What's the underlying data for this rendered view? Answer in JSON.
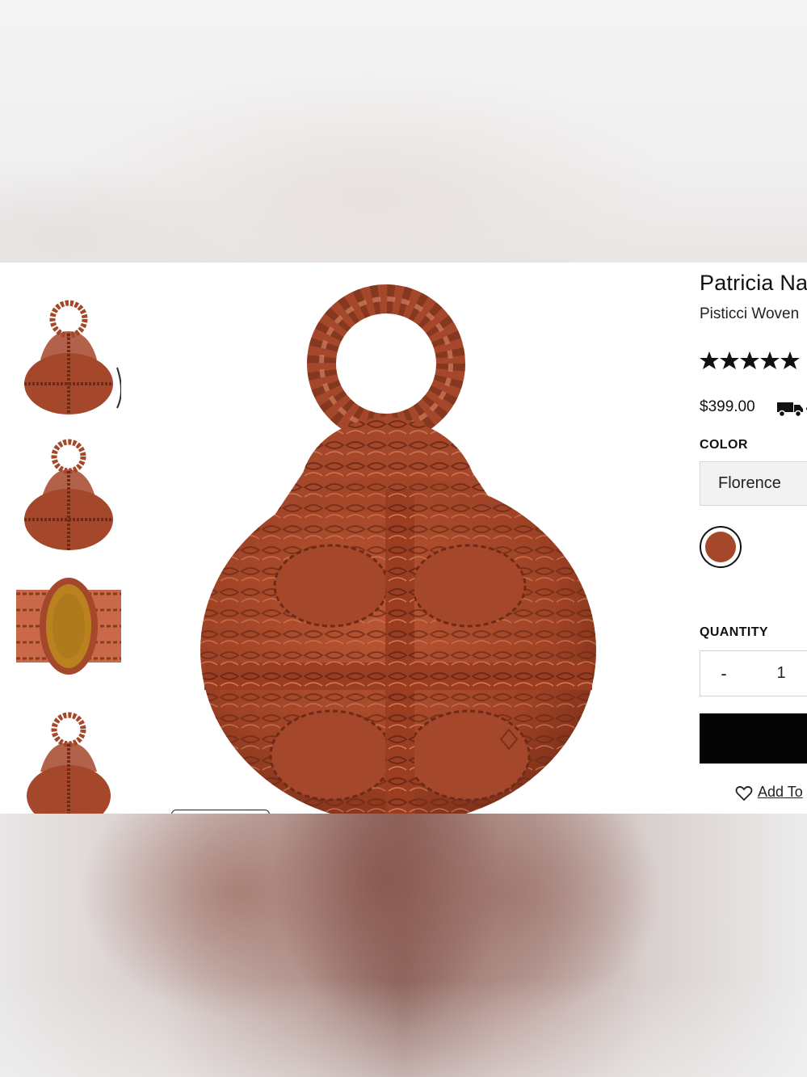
{
  "product": {
    "brand": "Patricia Na",
    "subtitle": "Pisticci Woven",
    "rating_stars": 5,
    "price": "$399.00"
  },
  "color": {
    "label": "COLOR",
    "selected": "Florence",
    "swatches": [
      {
        "name": "Florence",
        "hex": "#a5472a",
        "selected": true
      }
    ]
  },
  "quantity": {
    "label": "QUANTITY",
    "minus_label": "-",
    "value": "1"
  },
  "wishlist": {
    "label": "Add To"
  },
  "gallery": {
    "thumbnails": [
      "front-view",
      "back-view",
      "interior-view",
      "side-view"
    ],
    "selected_index": 0
  },
  "colors": {
    "leather": "#a5472a",
    "leather_dark": "#6e2a16",
    "leather_light": "#c9694a",
    "lining": "#b9821f",
    "button_bg": "#050505"
  }
}
